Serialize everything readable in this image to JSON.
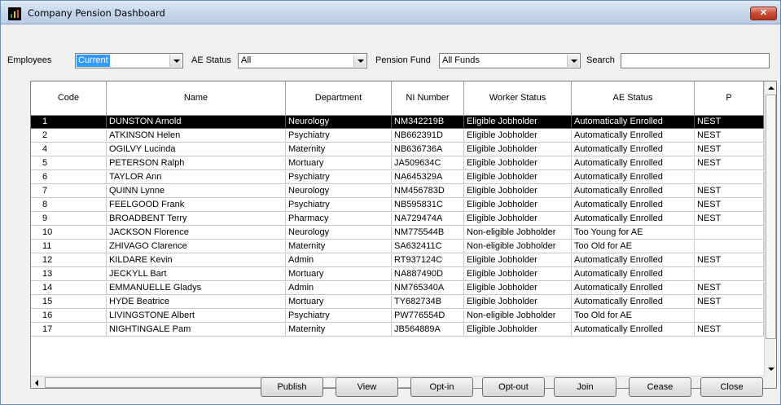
{
  "window": {
    "title": "Company Pension Dashboard",
    "close_glyph": "✕"
  },
  "filters": {
    "employees_label": "Employees",
    "employees_value": "Current",
    "ae_status_label": "AE Status",
    "ae_status_value": "All",
    "pension_fund_label": "Pension Fund",
    "pension_fund_value": "All Funds",
    "search_label": "Search",
    "search_value": ""
  },
  "table": {
    "columns": [
      "Code",
      "Name",
      "Department",
      "NI Number",
      "Worker Status",
      "AE Status",
      "P"
    ],
    "rows": [
      [
        "1",
        "DUNSTON Arnold",
        "Neurology",
        "NM342219B",
        "Eligible Jobholder",
        "Automatically Enrolled",
        "NEST"
      ],
      [
        "2",
        "ATKINSON Helen",
        "Psychiatry",
        "NB662391D",
        "Eligible Jobholder",
        "Automatically Enrolled",
        "NEST"
      ],
      [
        "4",
        "OGILVY Lucinda",
        "Maternity",
        "NB636736A",
        "Eligible Jobholder",
        "Automatically Enrolled",
        "NEST"
      ],
      [
        "5",
        "PETERSON Ralph",
        "Mortuary",
        "JA509634C",
        "Eligible Jobholder",
        "Automatically Enrolled",
        "NEST"
      ],
      [
        "6",
        "TAYLOR Ann",
        "Psychiatry",
        "NA645329A",
        "Eligible Jobholder",
        "Automatically Enrolled",
        ""
      ],
      [
        "7",
        "QUINN Lynne",
        "Neurology",
        "NM456783D",
        "Eligible Jobholder",
        "Automatically Enrolled",
        "NEST"
      ],
      [
        "8",
        "FEELGOOD Frank",
        "Psychiatry",
        "NB595831C",
        "Eligible Jobholder",
        "Automatically Enrolled",
        "NEST"
      ],
      [
        "9",
        "BROADBENT Terry",
        "Pharmacy",
        "NA729474A",
        "Eligible Jobholder",
        "Automatically Enrolled",
        "NEST"
      ],
      [
        "10",
        "JACKSON Florence",
        "Neurology",
        "NM775544B",
        "Non-eligible Jobholder",
        "Too Young for AE",
        ""
      ],
      [
        "11",
        "ZHIVAGO Clarence",
        "Maternity",
        "SA632411C",
        "Non-eligible Jobholder",
        "Too Old for AE",
        ""
      ],
      [
        "12",
        "KILDARE Kevin",
        "Admin",
        "RT937124C",
        "Eligible Jobholder",
        "Automatically Enrolled",
        "NEST"
      ],
      [
        "13",
        "JECKYLL Bart",
        "Mortuary",
        "NA887490D",
        "Eligible Jobholder",
        "Automatically Enrolled",
        ""
      ],
      [
        "14",
        "EMMANUELLE Gladys",
        "Admin",
        "NM765340A",
        "Eligible Jobholder",
        "Automatically Enrolled",
        "NEST"
      ],
      [
        "15",
        "HYDE Beatrice",
        "Mortuary",
        "TY682734B",
        "Eligible Jobholder",
        "Automatically Enrolled",
        "NEST"
      ],
      [
        "16",
        "LIVINGSTONE Albert",
        "Psychiatry",
        "PW776554D",
        "Non-eligible Jobholder",
        "Too Old for AE",
        ""
      ],
      [
        "17",
        "NIGHTINGALE Pam",
        "Maternity",
        "JB564889A",
        "Eligible Jobholder",
        "Automatically Enrolled",
        "NEST"
      ]
    ]
  },
  "buttons": [
    "Publish",
    "View",
    "Opt-in",
    "Opt-out",
    "Join",
    "Cease",
    "Close"
  ]
}
